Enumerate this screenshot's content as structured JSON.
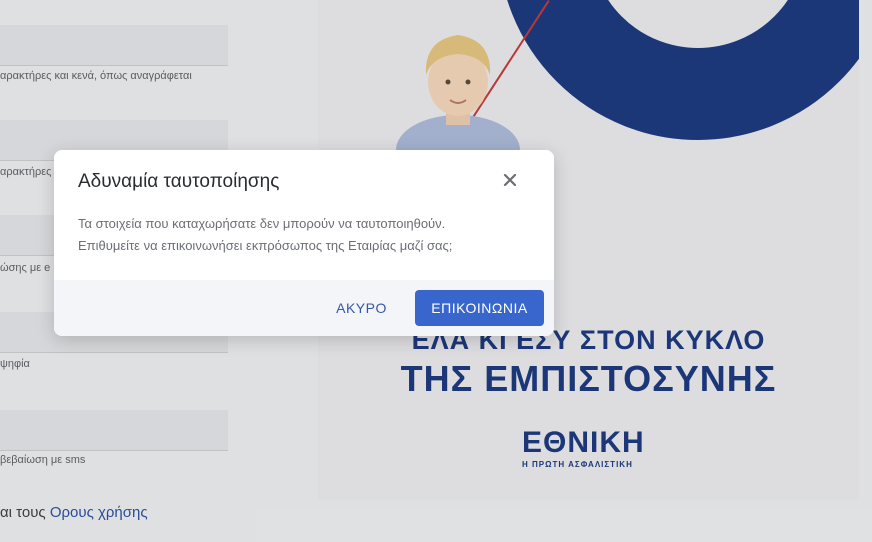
{
  "form": {
    "hint_1": "αρακτήρες και κενά, όπως αναγράφεται",
    "hint_2": "αρακτήρες",
    "hint_3": "ώσης με e",
    "hint_4": "ψηφία",
    "hint_5": "βεβαίωση με sms",
    "terms_prefix": "αι τους ",
    "terms_link": "Ορους χρήσης"
  },
  "promo": {
    "slogan_line_1": "ΕΛΑ ΚΙ ΕΣΥ ΣΤΟΝ ΚΥΚΛΟ",
    "slogan_line_2": "ΤΗΣ ΕΜΠΙΣΤΟΣΥΝΗΣ",
    "logo_text": "ΕΘΝΙΚΗ",
    "logo_tagline": "Η ΠΡΩΤΗ ΑΣΦΑΛΙΣΤΙΚΗ",
    "brand_color": "#1e3a7d"
  },
  "modal": {
    "title": "Αδυναμία ταυτοποίησης",
    "close_icon": "close-icon",
    "body_line_1": "Τα στοιχεία που καταχωρήσατε δεν μπορούν να ταυτοποιηθούν.",
    "body_line_2": "Επιθυμείτε να επικοινωνήσει εκπρόσωπος της Εταιρίας μαζί σας;",
    "cancel_label": "ΑΚΥΡΟ",
    "contact_label": "ΕΠΙΚΟΙΝΩΝΙΑ",
    "accent_color": "#3866cc"
  }
}
